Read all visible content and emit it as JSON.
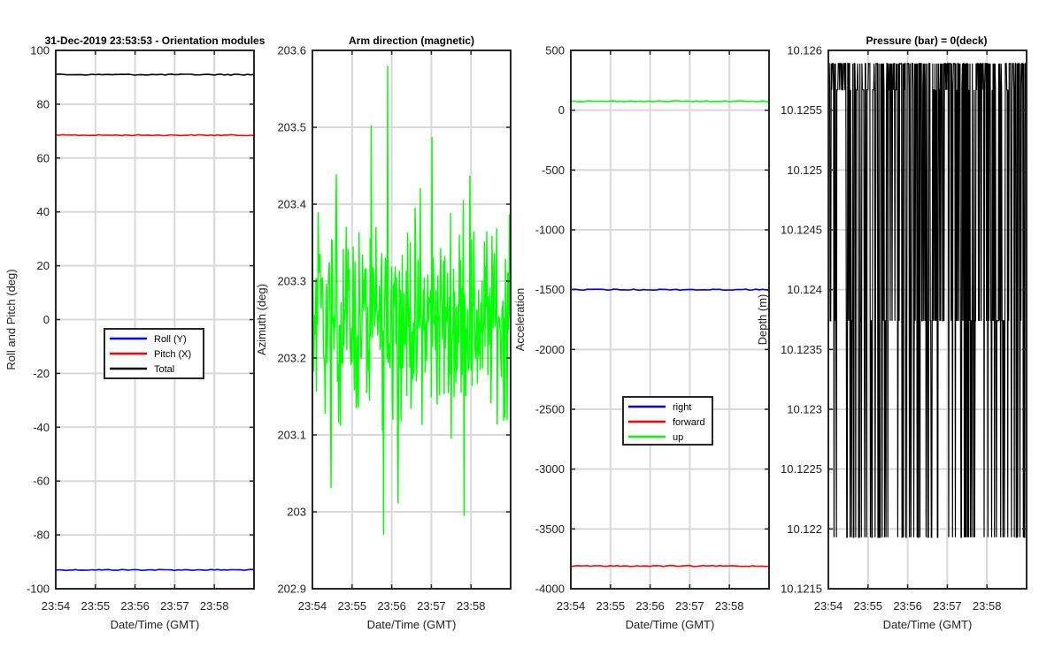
{
  "figure_title": "31-Dec-2019 23:53:53 - Orientation modules",
  "colors": {
    "roll": "#0000ff",
    "pitch": "#ff0000",
    "total": "#000000",
    "green": "#00ff00",
    "grid": "#d9d9d9",
    "axis": "#262626"
  },
  "chart_data": [
    {
      "type": "line",
      "title": "",
      "xlabel": "Date/Time (GMT)",
      "ylabel": "Roll and Pitch (deg)",
      "xticks": [
        "23:54",
        "23:55",
        "23:56",
        "23:57",
        "23:58"
      ],
      "xlim": [
        "23:54",
        "23:59"
      ],
      "ylim": [
        -100,
        100
      ],
      "yticks": [
        "100",
        "80",
        "60",
        "40",
        "20",
        "0",
        "-20",
        "-40",
        "-60",
        "-80",
        "-100"
      ],
      "grid": true,
      "legend": {
        "placement": "center",
        "entries": [
          "Roll (Y)",
          "Pitch (X)",
          "Total"
        ]
      },
      "series": [
        {
          "name": "Roll (Y)",
          "color": "#0000ff",
          "values": [
            -93,
            -93
          ]
        },
        {
          "name": "Pitch (X)",
          "color": "#ff0000",
          "values": [
            68.5,
            68.5
          ]
        },
        {
          "name": "Total",
          "color": "#000000",
          "values": [
            91,
            91
          ]
        }
      ]
    },
    {
      "type": "line",
      "title": "Arm direction (magnetic)",
      "xlabel": "",
      "ylabel": "Azimuth (deg)",
      "xticks": [
        "23:54",
        "23:55",
        "23:56",
        "23:57",
        "23:58"
      ],
      "xlim": [
        "23:54",
        "23:59"
      ],
      "ylim": [
        202.9,
        203.6
      ],
      "yticks": [
        "203.6",
        "203.5",
        "203.4",
        "203.3",
        "203.2",
        "203.1",
        "203",
        "202.9"
      ],
      "grid": true,
      "series": [
        {
          "color": "#00ff00",
          "mean": 203.25,
          "min": 202.97,
          "max": 203.58
        }
      ]
    },
    {
      "type": "line",
      "title": "",
      "xlabel": "Date/Time (GMT)",
      "ylabel": "Acceleration",
      "xticks": [
        "23:54",
        "23:55",
        "23:56",
        "23:57",
        "23:58"
      ],
      "xlim": [
        "23:54",
        "23:59"
      ],
      "ylim": [
        -4000,
        500
      ],
      "yticks": [
        "500",
        "0",
        "-500",
        "-1000",
        "-1500",
        "-2000",
        "-2500",
        "-3000",
        "-3500",
        "-4000"
      ],
      "grid": true,
      "legend": {
        "placement": "lower-center",
        "entries": [
          "right",
          "forward",
          "up"
        ]
      },
      "series": [
        {
          "name": "right",
          "color": "#0000ff",
          "values": [
            -1500,
            -1500
          ]
        },
        {
          "name": "forward",
          "color": "#ff0000",
          "values": [
            -3810,
            -3810
          ]
        },
        {
          "name": "up",
          "color": "#00ff00",
          "values": [
            75,
            75
          ]
        }
      ]
    },
    {
      "type": "line",
      "title": "Pressure (bar) = 0(deck)",
      "xlabel": "Date/Time (GMT)",
      "ylabel": "Depth (m)",
      "xticks": [
        "23:54",
        "23:55",
        "23:56",
        "23:57",
        "23:58"
      ],
      "xlim": [
        "23:54",
        "23:59"
      ],
      "ylim": [
        10.1215,
        10.126
      ],
      "yticks": [
        "10.126",
        "10.1255",
        "10.125",
        "10.1245",
        "10.124",
        "10.1235",
        "10.123",
        "10.1225",
        "10.122",
        "10.1215"
      ],
      "grid": true,
      "series": [
        {
          "color": "#000000",
          "levels": [
            10.12589,
            10.12567,
            10.12374,
            10.12193
          ]
        }
      ]
    }
  ]
}
